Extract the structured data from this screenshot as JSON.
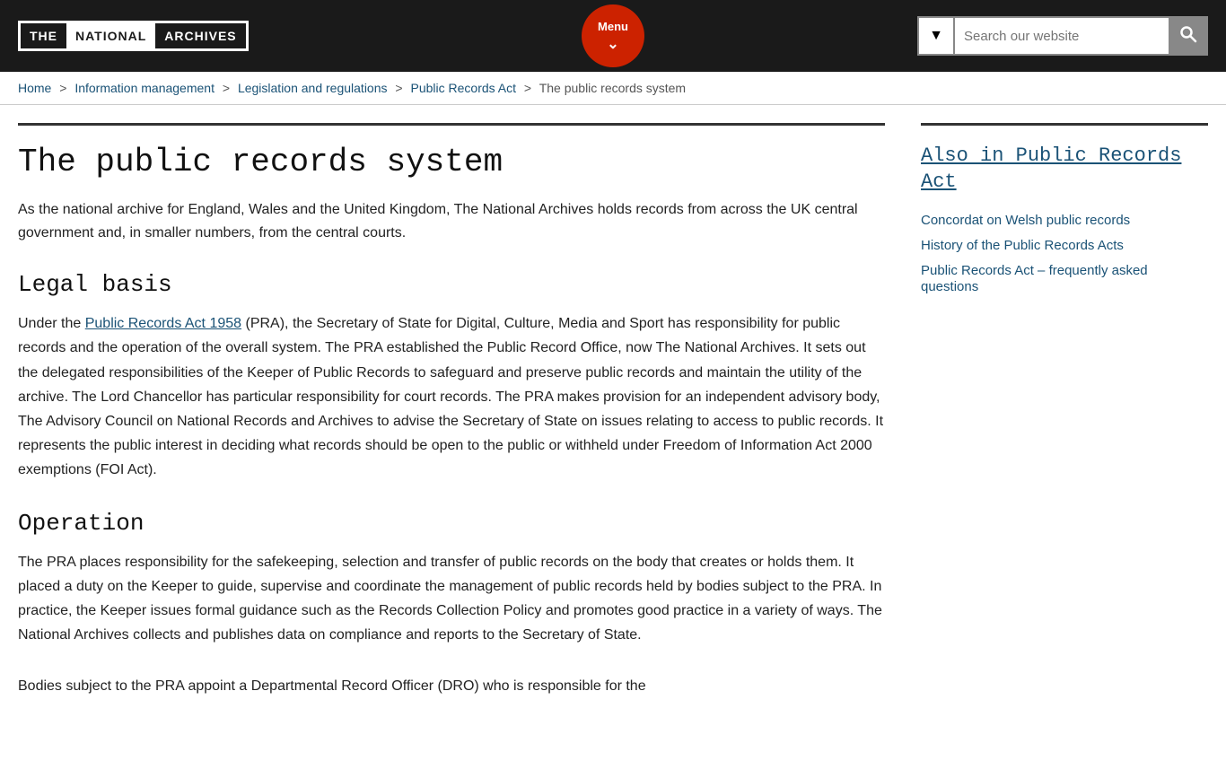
{
  "header": {
    "logo": {
      "the": "THE",
      "national": "NATIONAL",
      "archives": "ARCHIVES"
    },
    "menu_label": "Menu",
    "search_placeholder": "Search our website"
  },
  "breadcrumb": {
    "home": "Home",
    "information_management": "Information management",
    "legislation": "Legislation and regulations",
    "public_records_act": "Public Records Act",
    "current": "The public records system"
  },
  "main": {
    "page_title": "The public records system",
    "intro": "As the national archive for England, Wales and the United Kingdom, The National Archives holds records from across the UK central government and, in smaller numbers, from the central courts.",
    "sections": [
      {
        "id": "legal-basis",
        "heading": "Legal basis",
        "link_text": "Public Records Act 1958",
        "text_before": "Under the ",
        "text_after": " (PRA), the Secretary of State for Digital, Culture, Media and Sport has responsibility for public records and the operation of the overall system. The PRA established the Public Record Office, now The National Archives. It sets out the delegated responsibilities of the Keeper of Public Records to safeguard and preserve public records and maintain the utility of the archive. The Lord Chancellor has particular responsibility for court records. The PRA makes provision for an independent advisory body, The Advisory Council on National Records and Archives to advise the Secretary of State on issues relating to access to public records. It represents the public interest in deciding what records should be open to the public or withheld under Freedom of Information Act 2000 exemptions (FOI Act)."
      },
      {
        "id": "operation",
        "heading": "Operation",
        "text_full": "The PRA places responsibility for the safekeeping, selection and transfer of public records on the body that creates or holds them. It placed a duty on the Keeper to guide, supervise and coordinate the management of public records held by bodies subject to the PRA. In practice, the Keeper issues formal guidance such as the Records Collection Policy and promotes good practice in a variety of ways. The National Archives collects and publishes data on compliance and reports to the Secretary of State."
      },
      {
        "id": "bodies",
        "heading": "",
        "text_full": "Bodies subject to the PRA appoint a Departmental Record Officer (DRO) who is responsible for the"
      }
    ]
  },
  "sidebar": {
    "title": "Also in Public Records Act",
    "links": [
      "Concordat on Welsh public records",
      "History of the Public Records Acts",
      "Public Records Act – frequently asked questions"
    ]
  }
}
